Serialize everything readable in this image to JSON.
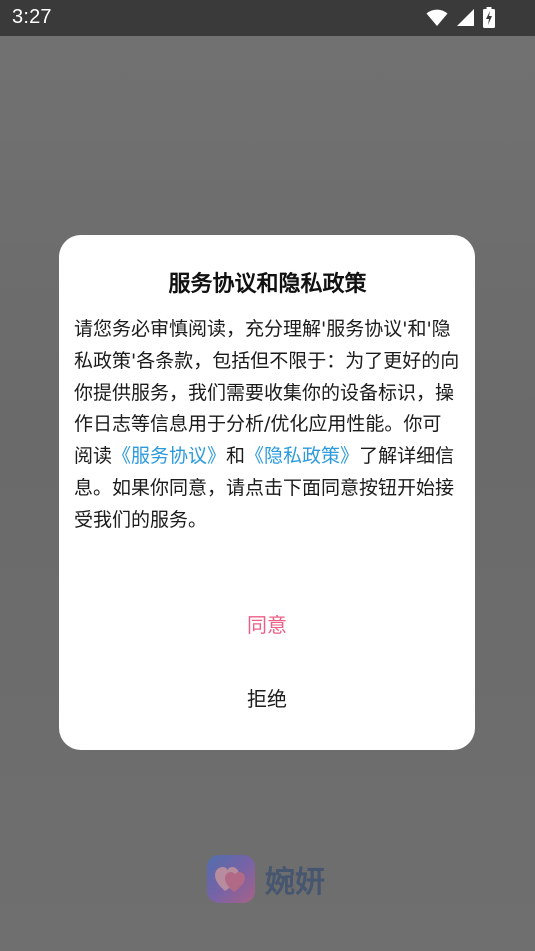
{
  "status_bar": {
    "time": "3:27",
    "icons": [
      "wifi-icon",
      "signal-icon",
      "battery-charging-icon"
    ]
  },
  "dialog": {
    "title": "服务协议和隐私政策",
    "body_part1": "请您务必审慎阅读，充分理解'服务协议'和'隐私政策'各条款，包括但不限于：为了更好的向你提供服务，我们需要收集你的设备标识，操作日志等信息用于分析/优化应用性能。你可阅读",
    "link_service": "《服务协议》",
    "body_part2": "和",
    "link_privacy": "《隐私政策》",
    "body_part3": "了解详细信息。如果你同意，请点击下面同意按钮开始接受我们的服务。",
    "agree_label": "同意",
    "reject_label": "拒绝"
  },
  "brand": {
    "name": "婉妍",
    "logo_icon": "double-heart-icon"
  },
  "colors": {
    "agree": "#ee5e87",
    "link": "#2b9bdd",
    "status_bar": "#3a3a3a"
  }
}
